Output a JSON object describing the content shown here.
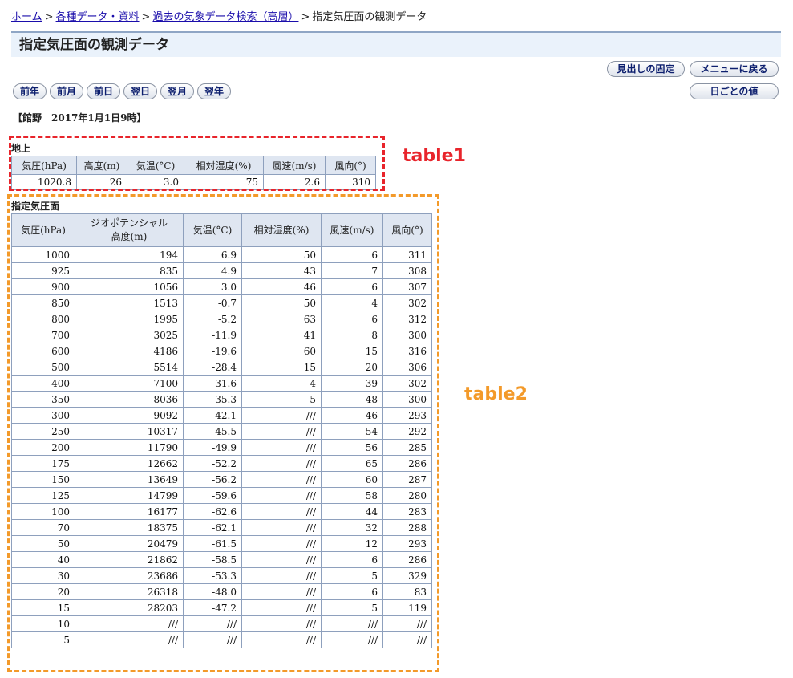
{
  "breadcrumb": {
    "home": "ホーム",
    "data": "各種データ・資料",
    "search": "過去の気象データ検索（高層）",
    "current": "指定気圧面の観測データ",
    "separator": ">"
  },
  "page_title": "指定気圧面の観測データ",
  "buttons": {
    "fix_header": "見出しの固定",
    "back_menu": "メニューに戻る",
    "daily": "日ごとの値",
    "nav": [
      "前年",
      "前月",
      "前日",
      "翌日",
      "翌月",
      "翌年"
    ]
  },
  "station": "【館野　2017年1月1日9時】",
  "surface": {
    "label": "地上",
    "headers": [
      "気圧(hPa)",
      "高度(m)",
      "気温(°C)",
      "相対湿度(%)",
      "風速(m/s)",
      "風向(°)"
    ],
    "row": [
      "1020.8",
      "26",
      "3.0",
      "75",
      "2.6",
      "310"
    ]
  },
  "levels": {
    "label": "指定気圧面",
    "headers": [
      "気圧(hPa)",
      "ジオポテンシャル高度(m)",
      "気温(°C)",
      "相対湿度(%)",
      "風速(m/s)",
      "風向(°)"
    ],
    "header_geo_line1": "ジオポテンシャル",
    "header_geo_line2": "高度(m)",
    "rows": [
      [
        "1000",
        "194",
        "6.9",
        "50",
        "6",
        "311"
      ],
      [
        "925",
        "835",
        "4.9",
        "43",
        "7",
        "308"
      ],
      [
        "900",
        "1056",
        "3.0",
        "46",
        "6",
        "307"
      ],
      [
        "850",
        "1513",
        "-0.7",
        "50",
        "4",
        "302"
      ],
      [
        "800",
        "1995",
        "-5.2",
        "63",
        "6",
        "312"
      ],
      [
        "700",
        "3025",
        "-11.9",
        "41",
        "8",
        "300"
      ],
      [
        "600",
        "4186",
        "-19.6",
        "60",
        "15",
        "316"
      ],
      [
        "500",
        "5514",
        "-28.4",
        "15",
        "20",
        "306"
      ],
      [
        "400",
        "7100",
        "-31.6",
        "4",
        "39",
        "302"
      ],
      [
        "350",
        "8036",
        "-35.3",
        "5",
        "48",
        "300"
      ],
      [
        "300",
        "9092",
        "-42.1",
        "///",
        "46",
        "293"
      ],
      [
        "250",
        "10317",
        "-45.5",
        "///",
        "54",
        "292"
      ],
      [
        "200",
        "11790",
        "-49.9",
        "///",
        "56",
        "285"
      ],
      [
        "175",
        "12662",
        "-52.2",
        "///",
        "65",
        "286"
      ],
      [
        "150",
        "13649",
        "-56.2",
        "///",
        "60",
        "287"
      ],
      [
        "125",
        "14799",
        "-59.6",
        "///",
        "58",
        "280"
      ],
      [
        "100",
        "16177",
        "-62.6",
        "///",
        "44",
        "283"
      ],
      [
        "70",
        "18375",
        "-62.1",
        "///",
        "32",
        "288"
      ],
      [
        "50",
        "20479",
        "-61.5",
        "///",
        "12",
        "293"
      ],
      [
        "40",
        "21862",
        "-58.5",
        "///",
        "6",
        "286"
      ],
      [
        "30",
        "23686",
        "-53.3",
        "///",
        "5",
        "329"
      ],
      [
        "20",
        "26318",
        "-48.0",
        "///",
        "6",
        "83"
      ],
      [
        "15",
        "28203",
        "-47.2",
        "///",
        "5",
        "119"
      ],
      [
        "10",
        "///",
        "///",
        "///",
        "///",
        "///"
      ],
      [
        "5",
        "///",
        "///",
        "///",
        "///",
        "///"
      ]
    ]
  },
  "annotations": {
    "table1_label": "table1",
    "table1_color": "#e8242b",
    "table2_label": "table2",
    "table2_color": "#f39a2a"
  }
}
